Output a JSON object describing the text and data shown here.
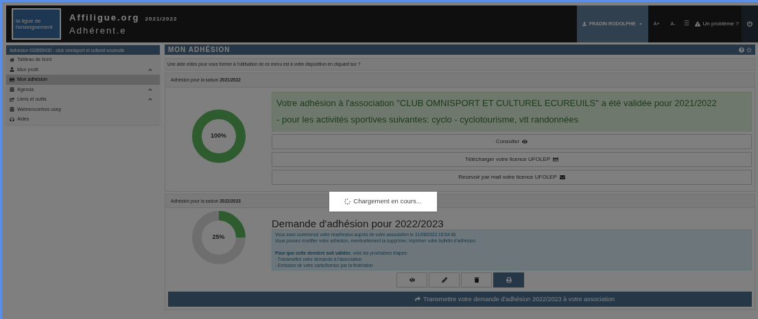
{
  "header": {
    "logo_text": "la ligue de l'enseignement",
    "app_name": "Affiligue.org",
    "season": "2021/2022",
    "subtitle": "Adhérent.e",
    "user": "FRADIN RODOLPHE",
    "font_up": "A+",
    "font_down": "A-",
    "menu": "☰",
    "problem": "Un problème ?"
  },
  "sidebar": {
    "title": "Adhésion 033555430 - club omnisport et culturel ecureuils",
    "items": [
      {
        "label": "Tableau de bord",
        "has_submenu": false,
        "selected": false
      },
      {
        "label": "Mon profil",
        "has_submenu": true,
        "selected": false
      },
      {
        "label": "Mon adhésion",
        "has_submenu": false,
        "selected": true
      },
      {
        "label": "Agenda",
        "has_submenu": true,
        "selected": false
      },
      {
        "label": "Liens et outils",
        "has_submenu": true,
        "selected": false
      },
      {
        "label": "Webrencontres usep",
        "has_submenu": false,
        "selected": false
      },
      {
        "label": "Aides",
        "has_submenu": false,
        "selected": false
      }
    ]
  },
  "main": {
    "title": "MON ADHÉSION",
    "help_text": "Une aide vidéo pour vous former à l'utilisation de ce menu est à votre disposition en cliquant sur ?",
    "seasons": [
      {
        "kind": "validated",
        "heading": "Adhésion pour la saison **2021/2022**",
        "percent": "100%",
        "messages": [
          "Votre adhésion à l'association \"CLUB OMNISPORT ET CULTUREL ECUREUILS\" a été validée pour 2021/2022",
          "- pour les activités sportives suivantes: cyclo - cyclotourisme, vtt randonnées"
        ],
        "actions": [
          "Consulter",
          "Télécharger votre licence UFOLEP",
          "Recevoir par mail votre licence UFOLEP"
        ]
      },
      {
        "kind": "pending",
        "heading": "Adhésion pour la saison **2022/2023**",
        "percent": "25%",
        "title": "Demande d'adhésion pour 2022/2023",
        "paragraphs": [
          [
            "Vous avez commencé votre réadhesion auprès de votre association le 31/08/2022 15:54:46",
            "Vous pouvez modifier votre adhésion, éventuellement la supprimer, imprimer votre bulletin d'adhésion."
          ],
          [
            "**Pour que cette dernière soit validée**, voici les prochaines étapes:",
            "- Transmettre votre demande à l'association",
            "- Emission de votre carte/licence par la fédération"
          ]
        ],
        "tools": [
          {
            "selected": false
          },
          {
            "selected": false
          },
          {
            "selected": false
          },
          {
            "selected": true
          }
        ],
        "submit": "Transmettre votre demande d'adhésion 2022/2023 à votre association"
      }
    ]
  },
  "loading": {
    "text": "Chargement en cours..."
  }
}
